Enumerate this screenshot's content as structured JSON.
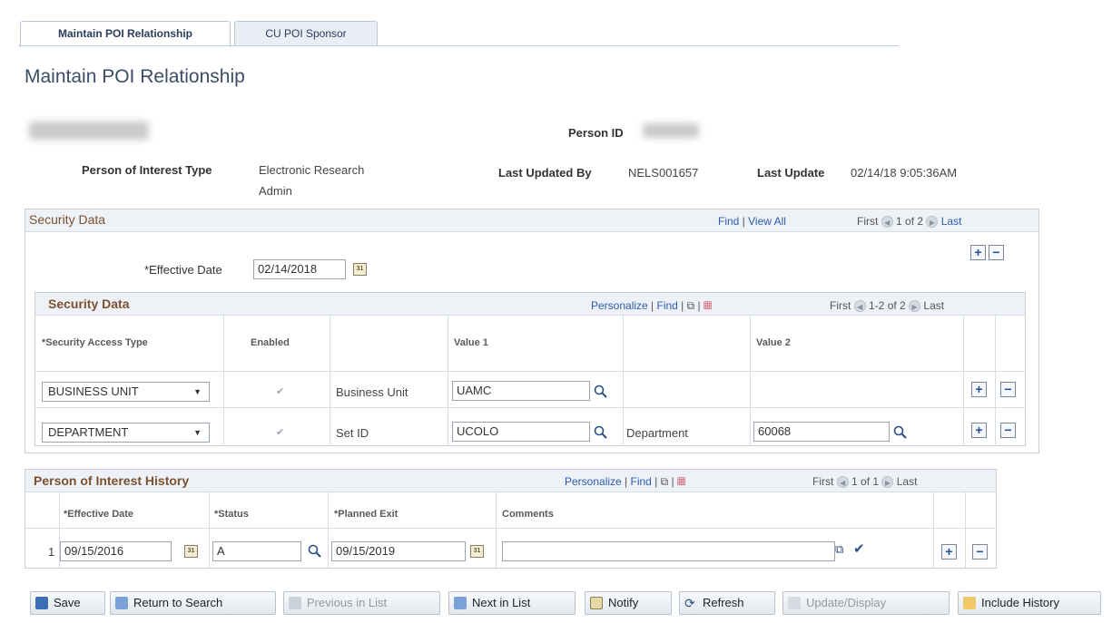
{
  "tabs": [
    {
      "label": "Maintain POI Relationship"
    },
    {
      "label": "CU POI Sponsor"
    }
  ],
  "page_title": "Maintain POI Relationship",
  "header": {
    "person_id_label": "Person ID",
    "poi_type_label": "Person of Interest Type",
    "poi_type_value_line1": "Electronic Research",
    "poi_type_value_line2": "Admin",
    "last_updated_by_label": "Last Updated By",
    "last_updated_by_value": "NELS001657",
    "last_update_label": "Last Update",
    "last_update_value": "02/14/18  9:05:36AM"
  },
  "security_outer": {
    "title": "Security Data",
    "find": "Find",
    "view_all": "View All",
    "first": "First",
    "count": "1 of 2",
    "last": "Last",
    "effective_date_label": "*Effective Date",
    "effective_date_value": "02/14/2018"
  },
  "security_grid": {
    "title": "Security Data",
    "personalize": "Personalize",
    "find": "Find",
    "first": "First",
    "count": "1-2 of 2",
    "last": "Last",
    "columns": {
      "access_type": "*Security Access Type",
      "enabled": "Enabled",
      "value1": "Value 1",
      "value2": "Value 2"
    },
    "rows": [
      {
        "access_type": "BUSINESS UNIT",
        "enabled": true,
        "label1": "Business Unit",
        "value1": "UAMC",
        "label2": "",
        "value2": ""
      },
      {
        "access_type": "DEPARTMENT",
        "enabled": true,
        "label1": "Set ID",
        "value1": "UCOLO",
        "label2": "Department",
        "value2": "60068"
      }
    ]
  },
  "history_grid": {
    "title": "Person of Interest History",
    "personalize": "Personalize",
    "find": "Find",
    "first": "First",
    "count": "1 of 1",
    "last": "Last",
    "columns": {
      "effective_date": "*Effective Date",
      "status": "*Status",
      "planned_exit": "*Planned Exit",
      "comments": "Comments"
    },
    "rows": [
      {
        "row_num": "1",
        "effective_date": "09/15/2016",
        "status": "A",
        "planned_exit": "09/15/2019",
        "comments": ""
      }
    ]
  },
  "toolbar": {
    "save": "Save",
    "return_to_search": "Return to Search",
    "previous_in_list": "Previous in List",
    "next_in_list": "Next in List",
    "notify": "Notify",
    "refresh": "Refresh",
    "update_display": "Update/Display",
    "include_history": "Include History"
  }
}
